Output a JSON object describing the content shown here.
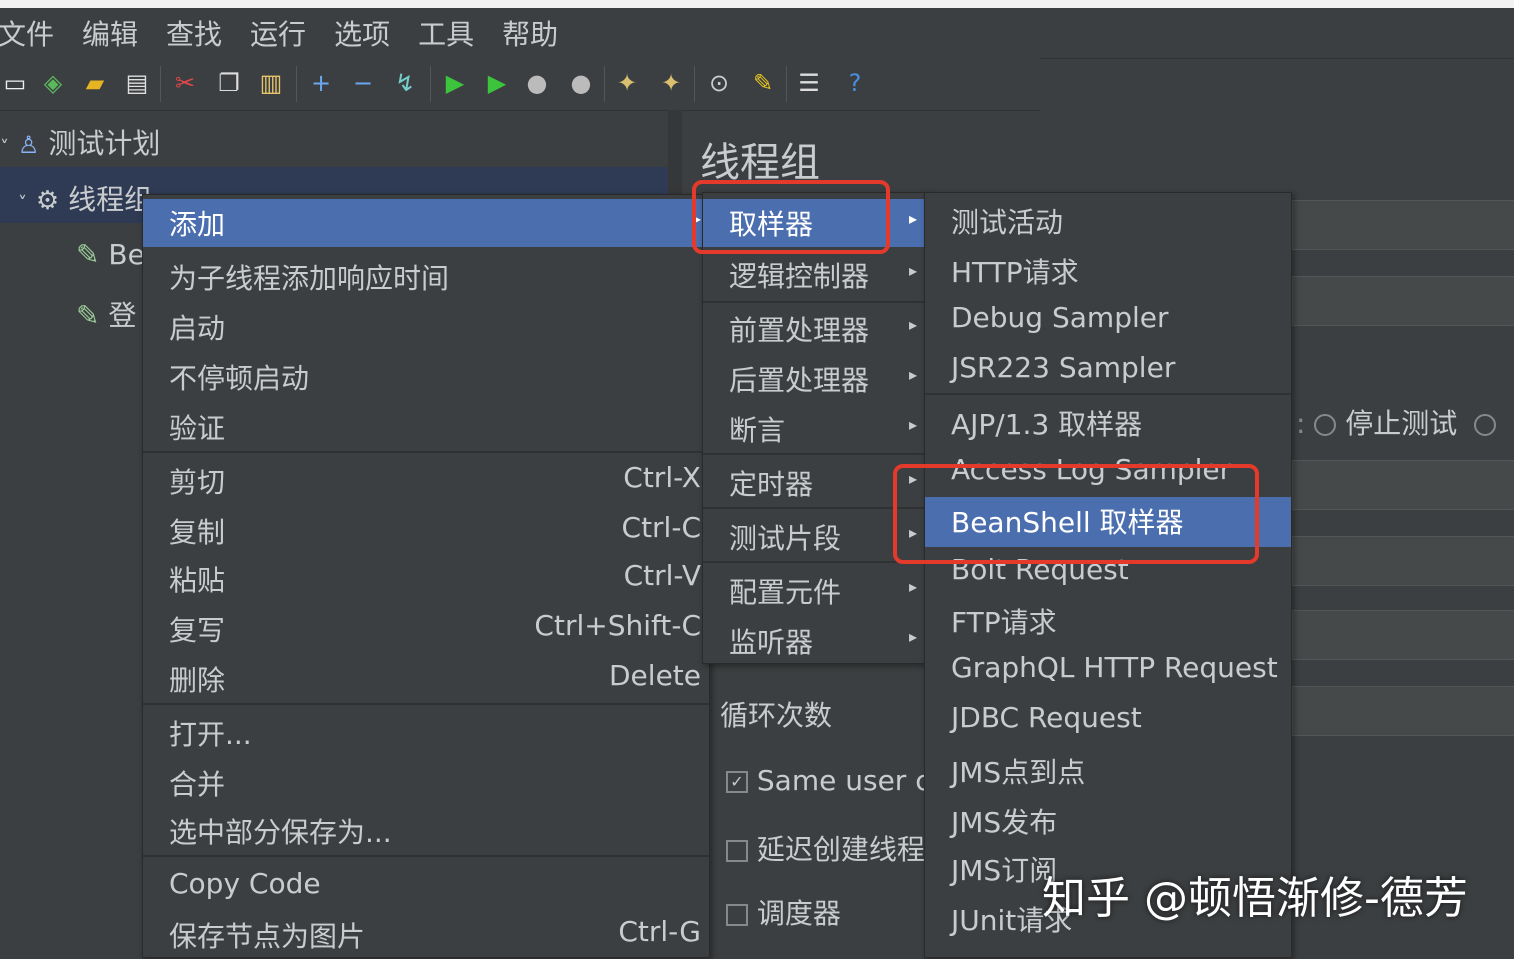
{
  "menubar": [
    "文件",
    "编辑",
    "查找",
    "运行",
    "选项",
    "工具",
    "帮助"
  ],
  "tree": {
    "plan": "测试计划",
    "thread_group": "线程组",
    "child1": "Be",
    "child2": "登"
  },
  "panel": {
    "title": "线程组",
    "stop_test": "停止测试",
    "loop_label": "循环次数",
    "same_user": "Same user c",
    "delay_create": "延迟创建线程",
    "scheduler": "调度器"
  },
  "context_menu": {
    "add": "添加",
    "items1": [
      "为子线程添加响应时间",
      "启动",
      "不停顿启动",
      "验证"
    ],
    "edit": [
      {
        "label": "剪切",
        "shortcut": "Ctrl-X"
      },
      {
        "label": "复制",
        "shortcut": "Ctrl-C"
      },
      {
        "label": "粘贴",
        "shortcut": "Ctrl-V"
      },
      {
        "label": "复写",
        "shortcut": "Ctrl+Shift-C"
      },
      {
        "label": "删除",
        "shortcut": "Delete"
      }
    ],
    "file": [
      "打开...",
      "合并",
      "选中部分保存为..."
    ],
    "copy_code": "Copy Code",
    "save_image": {
      "label": "保存节点为图片",
      "shortcut": "Ctrl-G"
    }
  },
  "add_menu": [
    "取样器",
    "逻辑控制器",
    "前置处理器",
    "后置处理器",
    "断言",
    "定时器",
    "测试片段",
    "配置元件",
    "监听器"
  ],
  "sampler_menu": [
    "测试活动",
    "HTTP请求",
    "Debug Sampler",
    "JSR223 Sampler",
    "AJP/1.3 取样器",
    "Access Log Sampler",
    "BeanShell 取样器",
    "Bolt Request",
    "FTP请求",
    "GraphQL HTTP Request",
    "JDBC Request",
    "JMS点到点",
    "JMS发布",
    "JMS订阅",
    "JUnit请求"
  ],
  "watermark": "知乎 @顿悟渐修-德芳",
  "colors": {
    "highlight": "#4b6eaf",
    "annotation": "#e43a2c"
  }
}
